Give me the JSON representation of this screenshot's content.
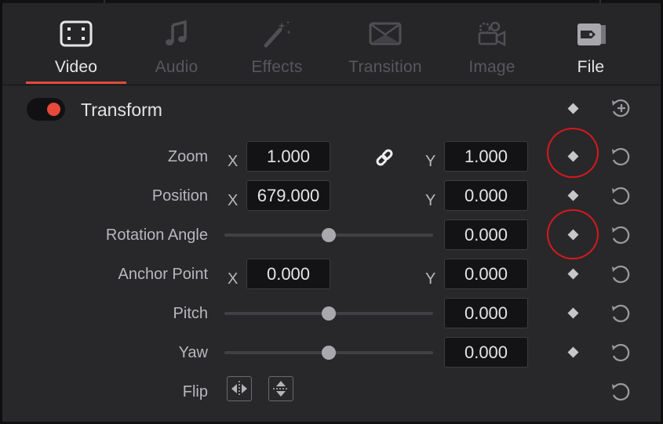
{
  "tabs": [
    {
      "label": "Video",
      "icon": "film-icon",
      "state": "active"
    },
    {
      "label": "Audio",
      "icon": "music-note-icon",
      "state": "disabled"
    },
    {
      "label": "Effects",
      "icon": "magic-wand-icon",
      "state": "disabled"
    },
    {
      "label": "Transition",
      "icon": "transition-icon",
      "state": "disabled"
    },
    {
      "label": "Image",
      "icon": "camera-icon",
      "state": "disabled"
    },
    {
      "label": "File",
      "icon": "file-tag-icon",
      "state": "enabled"
    }
  ],
  "accent_color": "#e24a3c",
  "annotation_color": "#d8181c",
  "section": {
    "title": "Transform",
    "enabled": true
  },
  "rows": {
    "zoom": {
      "label": "Zoom",
      "x_axis": "X",
      "x_value": "1.000",
      "y_axis": "Y",
      "y_value": "1.000",
      "linked": true
    },
    "position": {
      "label": "Position",
      "x_axis": "X",
      "x_value": "679.000",
      "y_axis": "Y",
      "y_value": "0.000"
    },
    "rotation": {
      "label": "Rotation Angle",
      "value": "0.000",
      "slider_fraction": 0.5
    },
    "anchor": {
      "label": "Anchor Point",
      "x_axis": "X",
      "x_value": "0.000",
      "y_axis": "Y",
      "y_value": "0.000"
    },
    "pitch": {
      "label": "Pitch",
      "value": "0.000",
      "slider_fraction": 0.5
    },
    "yaw": {
      "label": "Yaw",
      "value": "0.000",
      "slider_fraction": 0.5
    },
    "flip": {
      "label": "Flip"
    }
  }
}
